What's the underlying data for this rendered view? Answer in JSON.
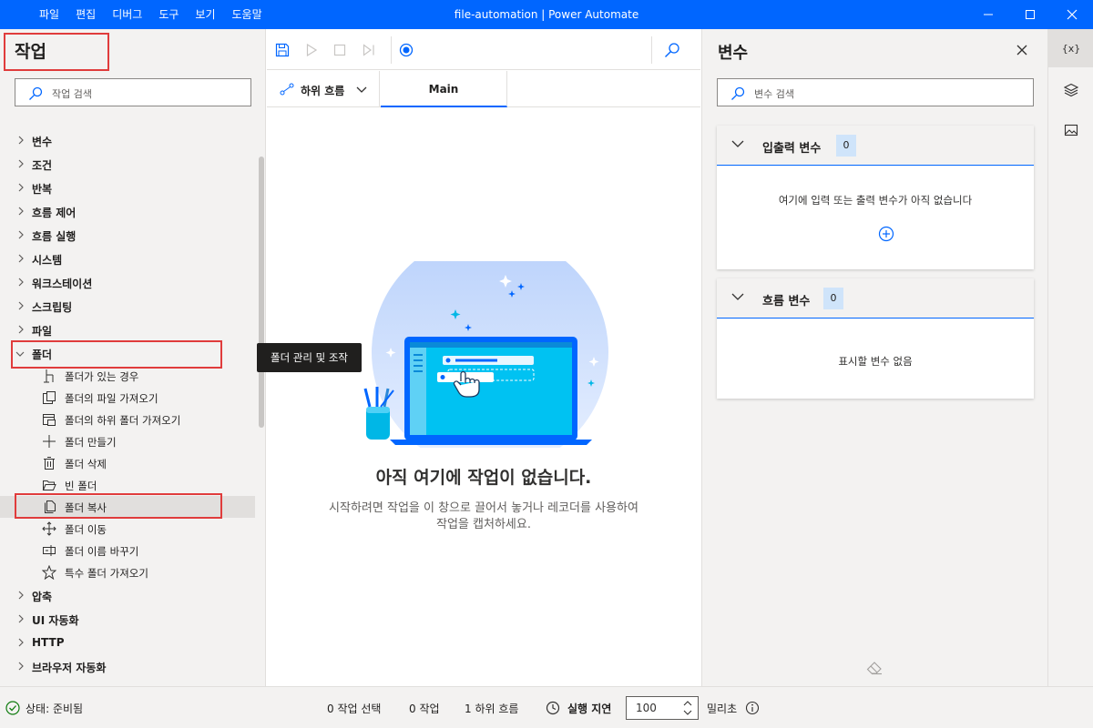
{
  "menu": [
    "파일",
    "편집",
    "디버그",
    "도구",
    "보기",
    "도움말"
  ],
  "window_title": "file-automation | Power Automate",
  "actions_pane": {
    "title": "작업",
    "search_placeholder": "작업 검색",
    "categories_top": [
      "변수",
      "조건",
      "반복",
      "흐름 제어",
      "흐름 실행",
      "시스템",
      "워크스테이션",
      "스크립팅",
      "파일"
    ],
    "expanded_category": "폴더",
    "folder_items": [
      {
        "label": "폴더가 있는 경우",
        "icon": "branch-icon"
      },
      {
        "label": "폴더의 파일 가져오기",
        "icon": "folder-files-icon"
      },
      {
        "label": "폴더의 하위 폴더 가져오기",
        "icon": "subfolder-icon"
      },
      {
        "label": "폴더 만들기",
        "icon": "plus-icon"
      },
      {
        "label": "폴더 삭제",
        "icon": "trash-icon"
      },
      {
        "label": "빈 폴더",
        "icon": "empty-folder-icon"
      },
      {
        "label": "폴더 복사",
        "icon": "copy-icon"
      },
      {
        "label": "폴더 이동",
        "icon": "move-icon"
      },
      {
        "label": "폴더 이름 바꾸기",
        "icon": "rename-icon"
      },
      {
        "label": "특수 폴더 가져오기",
        "icon": "star-icon"
      }
    ],
    "selected_item": "폴더 복사",
    "categories_bottom": [
      "압축",
      "UI 자동화",
      "HTTP",
      "브라우저 자동화"
    ],
    "tooltip": "폴더 관리 및 조작"
  },
  "designer": {
    "subflows_label": "하위 흐름",
    "main_tab": "Main",
    "empty_title": "아직 여기에 작업이 없습니다.",
    "empty_desc": "시작하려면 작업을 이 창으로 끌어서 놓거나 레코더를 사용하여 작업을 캡처하세요."
  },
  "variables_pane": {
    "title": "변수",
    "search_placeholder": "변수 검색",
    "io_section": {
      "label": "입출력 변수",
      "count": "0",
      "empty_text": "여기에 입력 또는 출력 변수가 아직 없습니다"
    },
    "flow_section": {
      "label": "흐름 변수",
      "count": "0",
      "empty_text": "표시할 변수 없음"
    }
  },
  "rail": {
    "variables_label": "{x}"
  },
  "status_bar": {
    "status": "상태: 준비됨",
    "selected": "0 작업 선택",
    "actions": "0 작업",
    "subflows": "1 하위 흐름",
    "delay_label": "실행 지연",
    "delay_value": "100",
    "unit": "밀리초"
  },
  "colors": {
    "accent": "#0066ff",
    "highlight_box": "#e03c3c",
    "status_ok": "#107c10"
  }
}
